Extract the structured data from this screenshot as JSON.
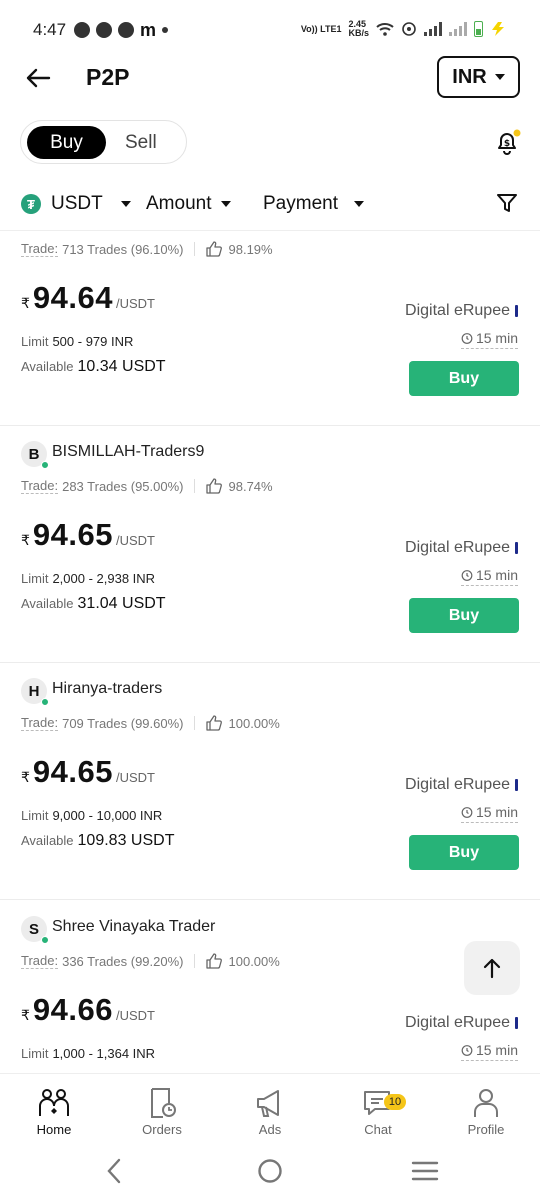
{
  "status": {
    "time": "4:47",
    "network_speed": "2.45",
    "network_unit": "KB/s",
    "carrier": "Vo)) LTE1"
  },
  "header": {
    "title": "P2P",
    "currency": "INR"
  },
  "toggle": {
    "buy": "Buy",
    "sell": "Sell"
  },
  "filters": {
    "coin": "USDT",
    "amount": "Amount",
    "payment": "Payment"
  },
  "ads": [
    {
      "initial": "",
      "name": "",
      "trade_label": "Trade:",
      "trades": "713 Trades (96.10%)",
      "rating": "98.19%",
      "currency_symbol": "₹",
      "price": "94.64",
      "unit": "/USDT",
      "limit_label": "Limit",
      "limit": "500 - 979 INR",
      "available_label": "Available",
      "available": "10.34 USDT",
      "payment": "Digital eRupee",
      "time_limit": "15 min",
      "action": "Buy"
    },
    {
      "initial": "B",
      "name": "BISMILLAH-Traders9",
      "trade_label": "Trade:",
      "trades": "283 Trades (95.00%)",
      "rating": "98.74%",
      "currency_symbol": "₹",
      "price": "94.65",
      "unit": "/USDT",
      "limit_label": "Limit",
      "limit": "2,000 - 2,938 INR",
      "available_label": "Available",
      "available": "31.04 USDT",
      "payment": "Digital eRupee",
      "time_limit": "15 min",
      "action": "Buy"
    },
    {
      "initial": "H",
      "name": "Hiranya-traders",
      "trade_label": "Trade:",
      "trades": "709 Trades (99.60%)",
      "rating": "100.00%",
      "currency_symbol": "₹",
      "price": "94.65",
      "unit": "/USDT",
      "limit_label": "Limit",
      "limit": "9,000 - 10,000 INR",
      "available_label": "Available",
      "available": "109.83 USDT",
      "payment": "Digital eRupee",
      "time_limit": "15 min",
      "action": "Buy"
    },
    {
      "initial": "S",
      "name": "Shree Vinayaka Trader",
      "trade_label": "Trade:",
      "trades": "336 Trades (99.20%)",
      "rating": "100.00%",
      "currency_symbol": "₹",
      "price": "94.66",
      "unit": "/USDT",
      "limit_label": "Limit",
      "limit": "1,000 - 1,364 INR",
      "available_label": "Available",
      "available": "",
      "payment": "Digital eRupee",
      "time_limit": "15 min",
      "action": ""
    }
  ],
  "bottom_nav": {
    "home": "Home",
    "orders": "Orders",
    "ads": "Ads",
    "chat": "Chat",
    "chat_badge": "10",
    "profile": "Profile"
  },
  "colors": {
    "accent_green": "#27b378",
    "badge_yellow": "#f5c518",
    "tether_green": "#26a17b"
  }
}
